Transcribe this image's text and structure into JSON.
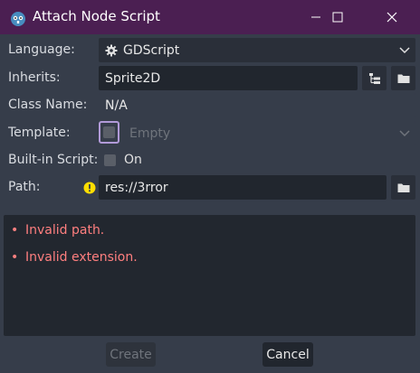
{
  "window": {
    "title": "Attach Node Script"
  },
  "form": {
    "language": {
      "label": "Language:",
      "value": "GDScript"
    },
    "inherits": {
      "label": "Inherits:",
      "value": "Sprite2D"
    },
    "class_name": {
      "label": "Class Name:",
      "value": "N/A"
    },
    "template": {
      "label": "Template:",
      "value": "Empty",
      "enabled": false
    },
    "builtin": {
      "label": "Built-in Script:",
      "option": "On",
      "checked": false
    },
    "path": {
      "label": "Path:",
      "value": "res://3rror",
      "status": "warning"
    }
  },
  "messages": [
    {
      "text": "Invalid path.",
      "bullet": "•"
    },
    {
      "text": "Invalid extension.",
      "bullet": "•"
    }
  ],
  "buttons": {
    "create": "Create",
    "cancel": "Cancel"
  },
  "colors": {
    "titlebar": "#4b1f52",
    "background": "#363d4a",
    "field": "#21262e",
    "error": "#ff7f7f",
    "warning": "#ffdd00",
    "focus": "#b19ad8"
  }
}
